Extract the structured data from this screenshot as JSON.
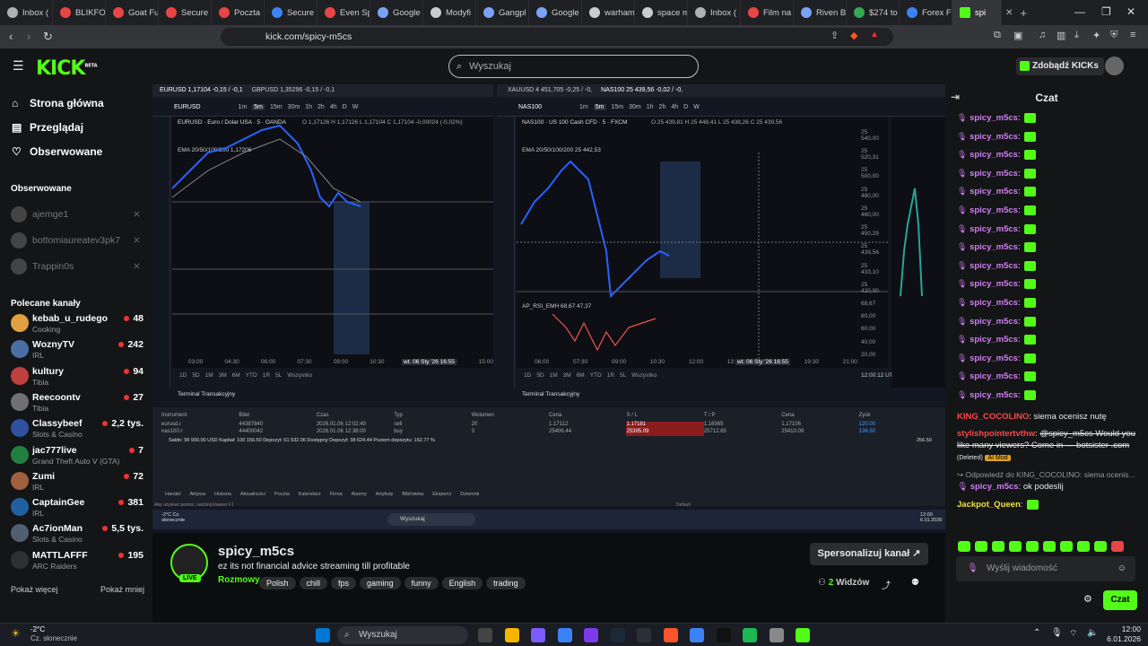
{
  "browser": {
    "tabs": [
      {
        "label": "Inbox (",
        "color": "#b0b0b0"
      },
      {
        "label": "BLIKFO",
        "color": "#e84545"
      },
      {
        "label": "Goat Fu",
        "color": "#e84545"
      },
      {
        "label": "Secure",
        "color": "#e84545"
      },
      {
        "label": "Poczta",
        "color": "#e84545"
      },
      {
        "label": "Secure",
        "color": "#3b82f6"
      },
      {
        "label": "Even Sp",
        "color": "#e84545"
      },
      {
        "label": "Google",
        "color": "#7aa2f7"
      },
      {
        "label": "Modyfi",
        "color": "#cccccc"
      },
      {
        "label": "Gangpl",
        "color": "#7aa2f7"
      },
      {
        "label": "Google",
        "color": "#7aa2f7"
      },
      {
        "label": "warham",
        "color": "#cccccc"
      },
      {
        "label": "space m",
        "color": "#cccccc"
      },
      {
        "label": "Inbox (",
        "color": "#b0b0b0"
      },
      {
        "label": "Film na",
        "color": "#e84545"
      },
      {
        "label": "Riven B",
        "color": "#7aa2f7"
      },
      {
        "label": "$274 to",
        "color": "#34a853"
      },
      {
        "label": "Forex F",
        "color": "#3b82f6"
      }
    ],
    "active_tab": "spi",
    "url": "kick.com/spicy-m5cs"
  },
  "header": {
    "logo": "KICK",
    "logo_sup": "BETA",
    "search_placeholder": "Wyszukaj",
    "kicks_button": "Zdobądź KICKs"
  },
  "sidebar": {
    "nav": [
      {
        "label": "Strona główna",
        "icon": "home-icon"
      },
      {
        "label": "Przeglądaj",
        "icon": "browse-icon"
      },
      {
        "label": "Obserwowane",
        "icon": "heart-icon"
      }
    ],
    "following_title": "Obserwowane",
    "following": [
      "ajemge1",
      "bottomiaureatev3pk7",
      "Trappin0s"
    ],
    "recommended_title": "Polecane kanały",
    "recommended": [
      {
        "name": "kebab_u_rudego",
        "category": "Cooking",
        "viewers": "48",
        "avatar": "#e0a040"
      },
      {
        "name": "WoznyTV",
        "category": "IRL",
        "viewers": "242",
        "avatar": "#4a6fa5"
      },
      {
        "name": "kultury",
        "category": "Tibia",
        "viewers": "94",
        "avatar": "#c04040"
      },
      {
        "name": "Reecoontv",
        "category": "Tibia",
        "viewers": "27",
        "avatar": "#707070"
      },
      {
        "name": "Classybeef",
        "category": "Slots & Casino",
        "viewers": "2,2 tys.",
        "avatar": "#3050a0"
      },
      {
        "name": "jac777live",
        "category": "Grand Theft Auto V (GTA)",
        "viewers": "7",
        "avatar": "#208040"
      },
      {
        "name": "Zumi",
        "category": "IRL",
        "viewers": "72",
        "avatar": "#a06040"
      },
      {
        "name": "CaptainGee",
        "category": "IRL",
        "viewers": "381",
        "avatar": "#2060a0"
      },
      {
        "name": "Ac7ionMan",
        "category": "Slots & Casino",
        "viewers": "5,5 tys.",
        "avatar": "#506070"
      },
      {
        "name": "MATTLAFFF",
        "category": "ARC Raiders",
        "viewers": "195",
        "avatar": "#303030"
      }
    ],
    "show_more": "Pokaż więcej",
    "show_less": "Pokaż mniej"
  },
  "stream": {
    "left_tabs": [
      "EURUSD 1,17104 -0,15 / -0,1",
      "GBPUSD 1,35296 -0,15 / -0,1"
    ],
    "right_tabs": [
      "XAUUSD 4 451,705 -0,25 / -0,",
      "NAS100 25 439,56 -0,02 / -0,"
    ],
    "left_symbol": "EURUSD",
    "right_symbol": "NAS100",
    "timeframes": [
      "1m",
      "5m",
      "15m",
      "30m",
      "1h",
      "2h",
      "4h",
      "D",
      "W"
    ],
    "left_title": "EURUSD · Euro / Dolar USA · 5 · OANDA",
    "left_ohlc": "O 1,17126 H 1,17126 L 1,17104 C 1,17104 -0,00024 (-0,02%)",
    "right_title": "NAS100 · US 100 Cash CFD · 5 · FXCM",
    "right_ohlc": "O 25 439,81 H 25 448,41 L 25 438,26 C 25 439,56",
    "ema_left": "EMA 20/50/100/200 1,17206",
    "ema_right": "EMA 20/50/100/200 25 442,53",
    "rsi_label": "AP_RSI_EMH 68,67 47,37",
    "left_xaxis": [
      "03:00",
      "04:30",
      "06:00",
      "07:30",
      "09:00",
      "10:30",
      "12:00",
      "13:30",
      "15:00"
    ],
    "right_xaxis": [
      "06:00",
      "07:30",
      "09:00",
      "10:30",
      "12:00",
      "13:30",
      "15:00",
      "19:30",
      "21:00"
    ],
    "left_date": "wt. 06 Sty '26 16:55",
    "right_date": "wt. 06 Sty '26 16:55",
    "right_yaxis": [
      "25 540,00",
      "25 520,31",
      "25 500,00",
      "25 480,00",
      "25 460,00",
      "25 450,29",
      "25 439,56",
      "25 433,10",
      "25 420,00",
      "68,67",
      "80,00",
      "60,00",
      "40,00",
      "20,00"
    ],
    "ranges": [
      "1D",
      "5D",
      "1M",
      "3M",
      "6M",
      "YTD",
      "1R",
      "5L",
      "Wszystko"
    ],
    "time_right": "12:00:12 UTC+1",
    "terminal_title": "Terminal Transakcyjny",
    "terminal_cols": [
      "Instrument",
      "Bilet",
      "Czas",
      "Typ",
      "Wolumen",
      "Cena",
      "S / L",
      "T / P",
      "Cena",
      "Zysk"
    ],
    "terminal_rows": [
      [
        "eurusd.r",
        "44387840",
        "2026.01.06 12:02:49",
        "sell",
        "20",
        "1.17112",
        "1.17181",
        "1.16565",
        "1.17106",
        "120.00"
      ],
      [
        "nas100.r",
        "44400042",
        "2026.01.06 12:38:00",
        "buy",
        "3",
        "25406.44",
        "25395.09",
        "25712.65",
        "25410.09",
        "136.50"
      ]
    ],
    "balance": "Saldo: 99 900.00 USD  Kapitał: 100 156.50  Depozyt: 61 532.06  Dostępny Depozyt: 38 624.44  Poziom depozytu: 162.77 %",
    "balance_total": "256.50",
    "terminal_tabs": [
      "Handel",
      "Aktywa",
      "Historia",
      "Aktualności",
      "Poczta",
      "Kalendarz",
      "Firma",
      "Alarmy",
      "Artykuły",
      "Biblioteka",
      "Eksperci",
      "Dziennik"
    ],
    "status_left": "Aby uzyskać pomoc, naciśnij klawisz F1",
    "status_mid": "Default",
    "inner_weather": "-2°C Cz. słonecznie",
    "inner_search": "Wyszukaj",
    "inner_clock": "12:00 6.01.2026"
  },
  "channel": {
    "name": "spicy_m5cs",
    "live": "LIVE",
    "title": "ez  its not financial advice streaming till profitable",
    "category": "Rozmowy",
    "tags": [
      "Polish",
      "chill",
      "fps",
      "gaming",
      "funny",
      "English",
      "trading"
    ],
    "customize": "Spersonalizuj kanał",
    "viewers": "2",
    "viewers_label": "Widzów"
  },
  "chat": {
    "title": "Czat",
    "spam_user": "spicy_m5cs",
    "spam_count": 16,
    "messages": [
      {
        "user": "KING_COCOLINO",
        "color": "#fc4747",
        "text": "siema ocenisz nutę"
      },
      {
        "user": "stylishpointertvthw",
        "color": "#fc4747",
        "text": "@spicy_m5cs Would you like many viewers? Come in — botsister .com",
        "deleted": "(Deleted)",
        "badge": "AI Mod"
      },
      {
        "reply": "Odpowiedź do KING_COCOLINO: siema ocenis..."
      },
      {
        "user": "spicy_m5cs",
        "color": "#d07df5",
        "text": "ok podeslij"
      },
      {
        "user": "Jackpot_Queen",
        "color": "#f0e040",
        "text": ""
      }
    ],
    "input_placeholder": "Wyślij wiadomość",
    "send": "Czat"
  },
  "taskbar": {
    "weather_temp": "-2°C",
    "weather_desc": "Cz. słonecznie",
    "search": "Wyszukaj",
    "time": "12:00",
    "date": "6.01.2026"
  }
}
